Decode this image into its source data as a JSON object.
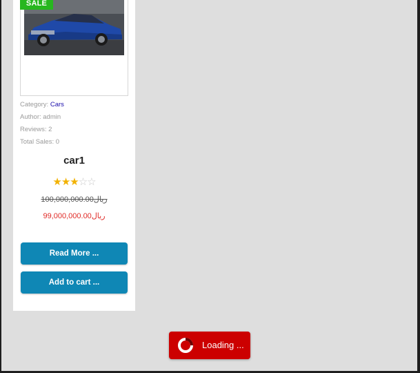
{
  "product": {
    "sale_badge": "SALE",
    "image_alt": "car1",
    "category_label": "Category:",
    "category_value": "Cars",
    "author": "Author: admin",
    "reviews": "Reviews: 2",
    "total_sales": "Total Sales: 0",
    "title": "car1",
    "rating": {
      "value": 3,
      "max": 5,
      "star_color": "#f2b203"
    },
    "regular_price": "100,000,000.00ريال",
    "sale_price": "99,000,000.00ريال",
    "read_more_label": "Read More ...",
    "add_to_cart_label": "Add to cart ..."
  },
  "loading": {
    "label": "Loading ..."
  },
  "colors": {
    "button_blue": "#0f87b5",
    "sale_green": "#27b71f",
    "loader_red": "#cc0000",
    "sale_price_red": "#e02b27"
  }
}
